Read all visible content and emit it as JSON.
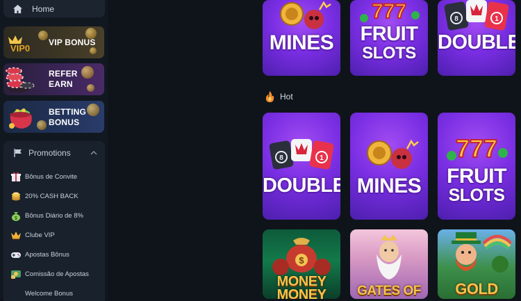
{
  "sidebar": {
    "home_label": "Home",
    "promos": [
      {
        "label": "VIP BONUS",
        "badge": "VIP0"
      },
      {
        "label_line1": "REFER",
        "label_line2": "EARN"
      },
      {
        "label_line1": "BETTING",
        "label_line2": "BONUS"
      }
    ],
    "menu": {
      "title": "Promotions",
      "items": [
        {
          "label": "Bônus de Convite",
          "icon": "gift-icon"
        },
        {
          "label": "20% CASH BACK",
          "icon": "coin-stack-icon"
        },
        {
          "label": "Bônus Diário de 8%",
          "icon": "money-bag-icon"
        },
        {
          "label": "Clube VIP",
          "icon": "crown-icon"
        },
        {
          "label": "Apostas Bônus",
          "icon": "gamepad-icon"
        },
        {
          "label": "Comissão de Apostas",
          "icon": "commission-icon"
        },
        {
          "label": "Welcome Bonus",
          "icon": ""
        }
      ]
    }
  },
  "main": {
    "hot_label": "Hot",
    "top_row": [
      {
        "line1": "MINES",
        "line2": ""
      },
      {
        "line1": "FRUIT",
        "line2": "SLOTS"
      },
      {
        "line1": "DOUBLE",
        "line2": ""
      }
    ],
    "hot_row": [
      {
        "line1": "DOUBLE",
        "line2": ""
      },
      {
        "line1": "MINES",
        "line2": ""
      },
      {
        "line1": "FRUIT",
        "line2": "SLOTS"
      }
    ],
    "bottom_row": [
      {
        "label": "MONEY MONEY"
      },
      {
        "label": "GATES OF"
      },
      {
        "label": "GOLD"
      }
    ],
    "double_numbers": [
      "8",
      "1"
    ]
  },
  "colors": {
    "background": "#0f141b",
    "sidebar": "#121820",
    "card_purple": "#7a2ee3",
    "text_gold": "#f6c24a"
  }
}
